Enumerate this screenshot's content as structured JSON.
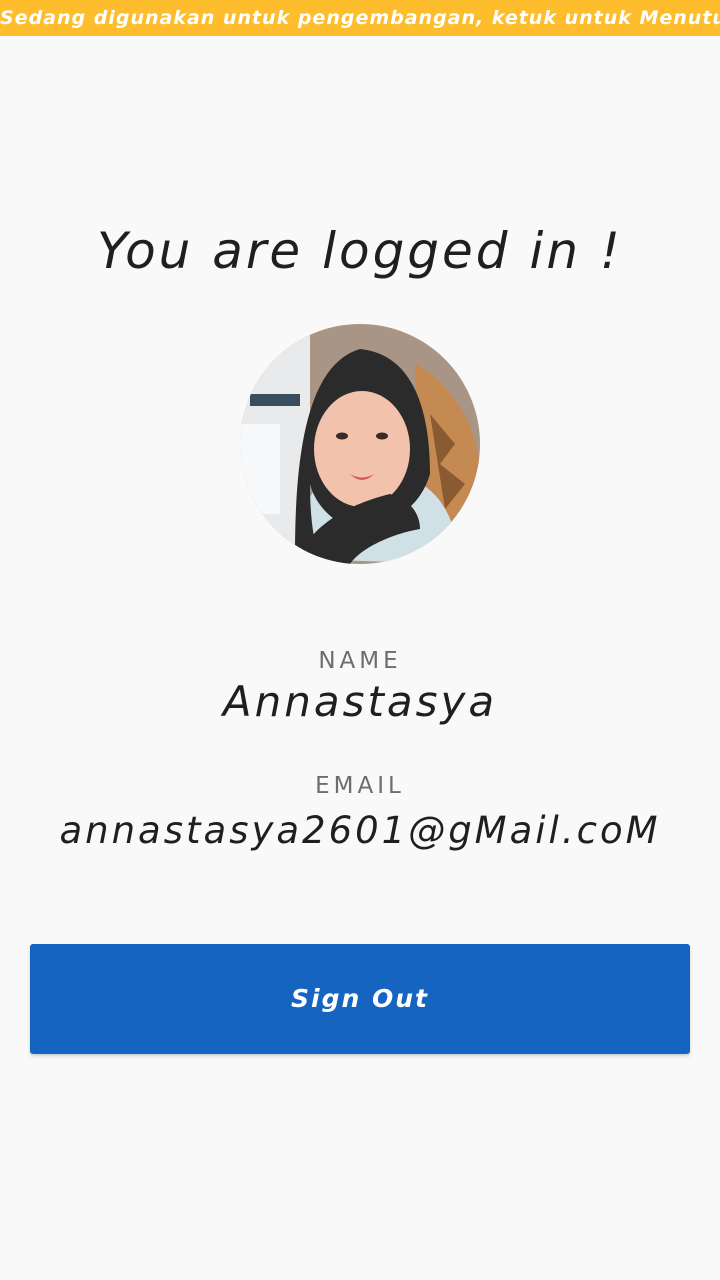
{
  "dev_banner": {
    "text": "Sedang digunakan untuk pengembangan, ketuk untuk Menutup",
    "background": "#fdbd2c"
  },
  "main": {
    "title": "You are logged in !",
    "profile": {
      "name_label": "NAME",
      "name_value": "Annastasya",
      "email_label": "EMAIL",
      "email_value": "annastasya2601@gMail.coM"
    },
    "sign_out_label": "Sign Out",
    "accent": "#1565c0"
  }
}
